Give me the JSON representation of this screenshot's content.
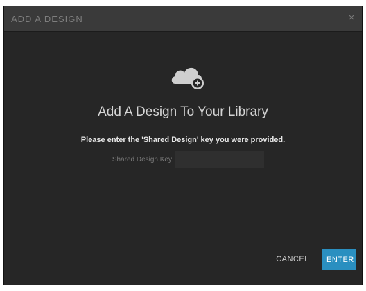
{
  "dialog": {
    "title": "ADD A DESIGN",
    "close_glyph": "×",
    "icon": "cloud-add-icon",
    "heading": "Add A Design To Your Library",
    "instruction": "Please enter the 'Shared Design' key you were provided.",
    "field": {
      "label": "Shared Design Key",
      "value": "",
      "placeholder": ""
    },
    "buttons": {
      "cancel": "CANCEL",
      "enter": "ENTER"
    }
  },
  "colors": {
    "background": "#262626",
    "titlebar": "#3a3a3a",
    "accent": "#2a8fc0",
    "icon": "#cfcfcf"
  }
}
